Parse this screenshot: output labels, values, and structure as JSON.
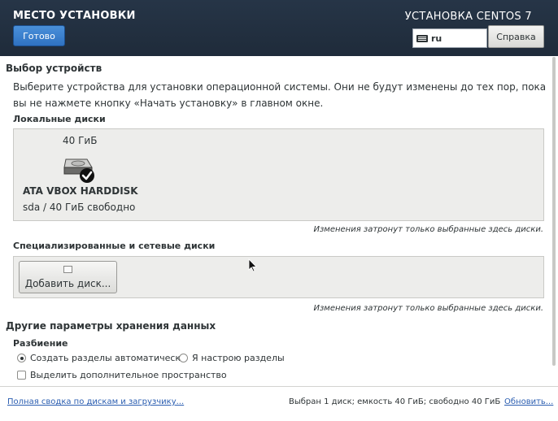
{
  "header": {
    "title": "МЕСТО УСТАНОВКИ",
    "done_label": "Готово",
    "product": "УСТАНОВКА CENTOS 7",
    "keyboard_layout": "ru",
    "help_label": "Справка"
  },
  "device_selection": {
    "heading": "Выбор устройств",
    "description": "Выберите устройства для установки операционной системы. Они не будут изменены до тех пор, пока вы не нажмете кнопку «Начать установку» в главном окне.",
    "local_heading": "Локальные диски",
    "disk": {
      "size": "40 ГиБ",
      "name": "ATA VBOX HARDDISK",
      "path_free": "sda  /  40 ГиБ свободно",
      "selected": true
    },
    "local_note": "Изменения затронут только выбранные здесь диски.",
    "special_heading": "Специализированные и сетевые диски",
    "add_disk_label": "Добавить диск...",
    "special_note": "Изменения затронут только выбранные здесь диски."
  },
  "storage_options": {
    "heading": "Другие параметры хранения данных",
    "partitioning_heading": "Разбиение",
    "auto_label": "Создать разделы автоматически",
    "manual_label": "Я настрою разделы",
    "auto_selected": true,
    "extra_space_label": "Выделить дополнительное пространство",
    "extra_space_checked": false
  },
  "footer": {
    "summary_link": "Полная сводка по дискам и загрузчику...",
    "status": "Выбран 1 диск; емкость 40 ГиБ; свободно 40 ГиБ",
    "refresh_link": "Обновить..."
  },
  "colors": {
    "header_bg": "#263547",
    "accent": "#2f72c2",
    "link": "#2a5db0",
    "panel_bg": "#ededeb"
  }
}
